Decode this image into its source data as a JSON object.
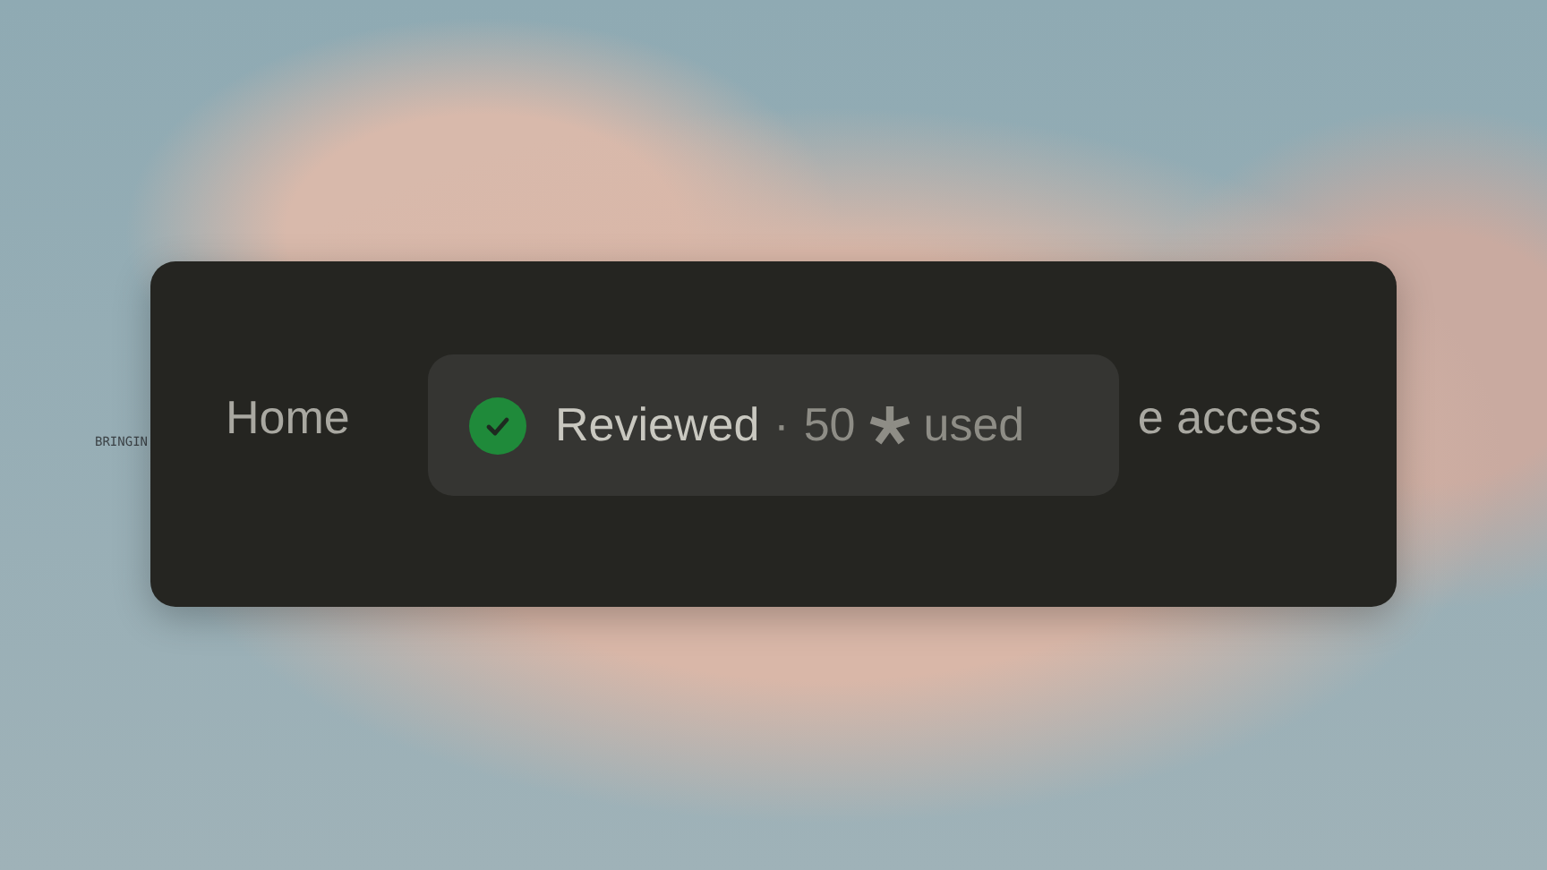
{
  "background": {
    "caption": "BRINGIN"
  },
  "nav": {
    "items": [
      {
        "label": "Home"
      },
      {
        "label": "e access"
      }
    ]
  },
  "toast": {
    "status": "Reviewed",
    "separator": "·",
    "amount": "50",
    "suffix": "used",
    "verified": true
  }
}
